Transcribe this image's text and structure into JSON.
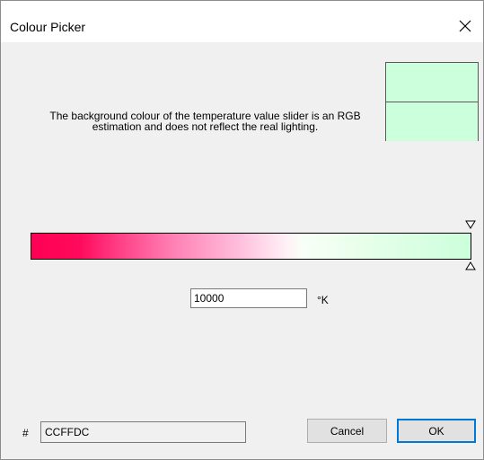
{
  "window": {
    "title": "Colour Picker"
  },
  "colors": {
    "selected": "#ccffdc",
    "title_bar": "#ffffff",
    "dialog_bg": "#f0f0f0",
    "ok_border": "#0078d7"
  },
  "icons": {
    "close": "close-icon",
    "slider_top": "triangle-down-icon",
    "slider_bottom": "triangle-up-icon"
  },
  "info": {
    "text": "The background colour of the temperature value slider is an RGB estimation and does not reflect the real lighting."
  },
  "temperature": {
    "value": "10000",
    "unit": "°K",
    "slider_fraction": 1.0
  },
  "hex": {
    "prefix": "#",
    "value": "CCFFDC"
  },
  "buttons": {
    "cancel": "Cancel",
    "ok": "OK"
  }
}
